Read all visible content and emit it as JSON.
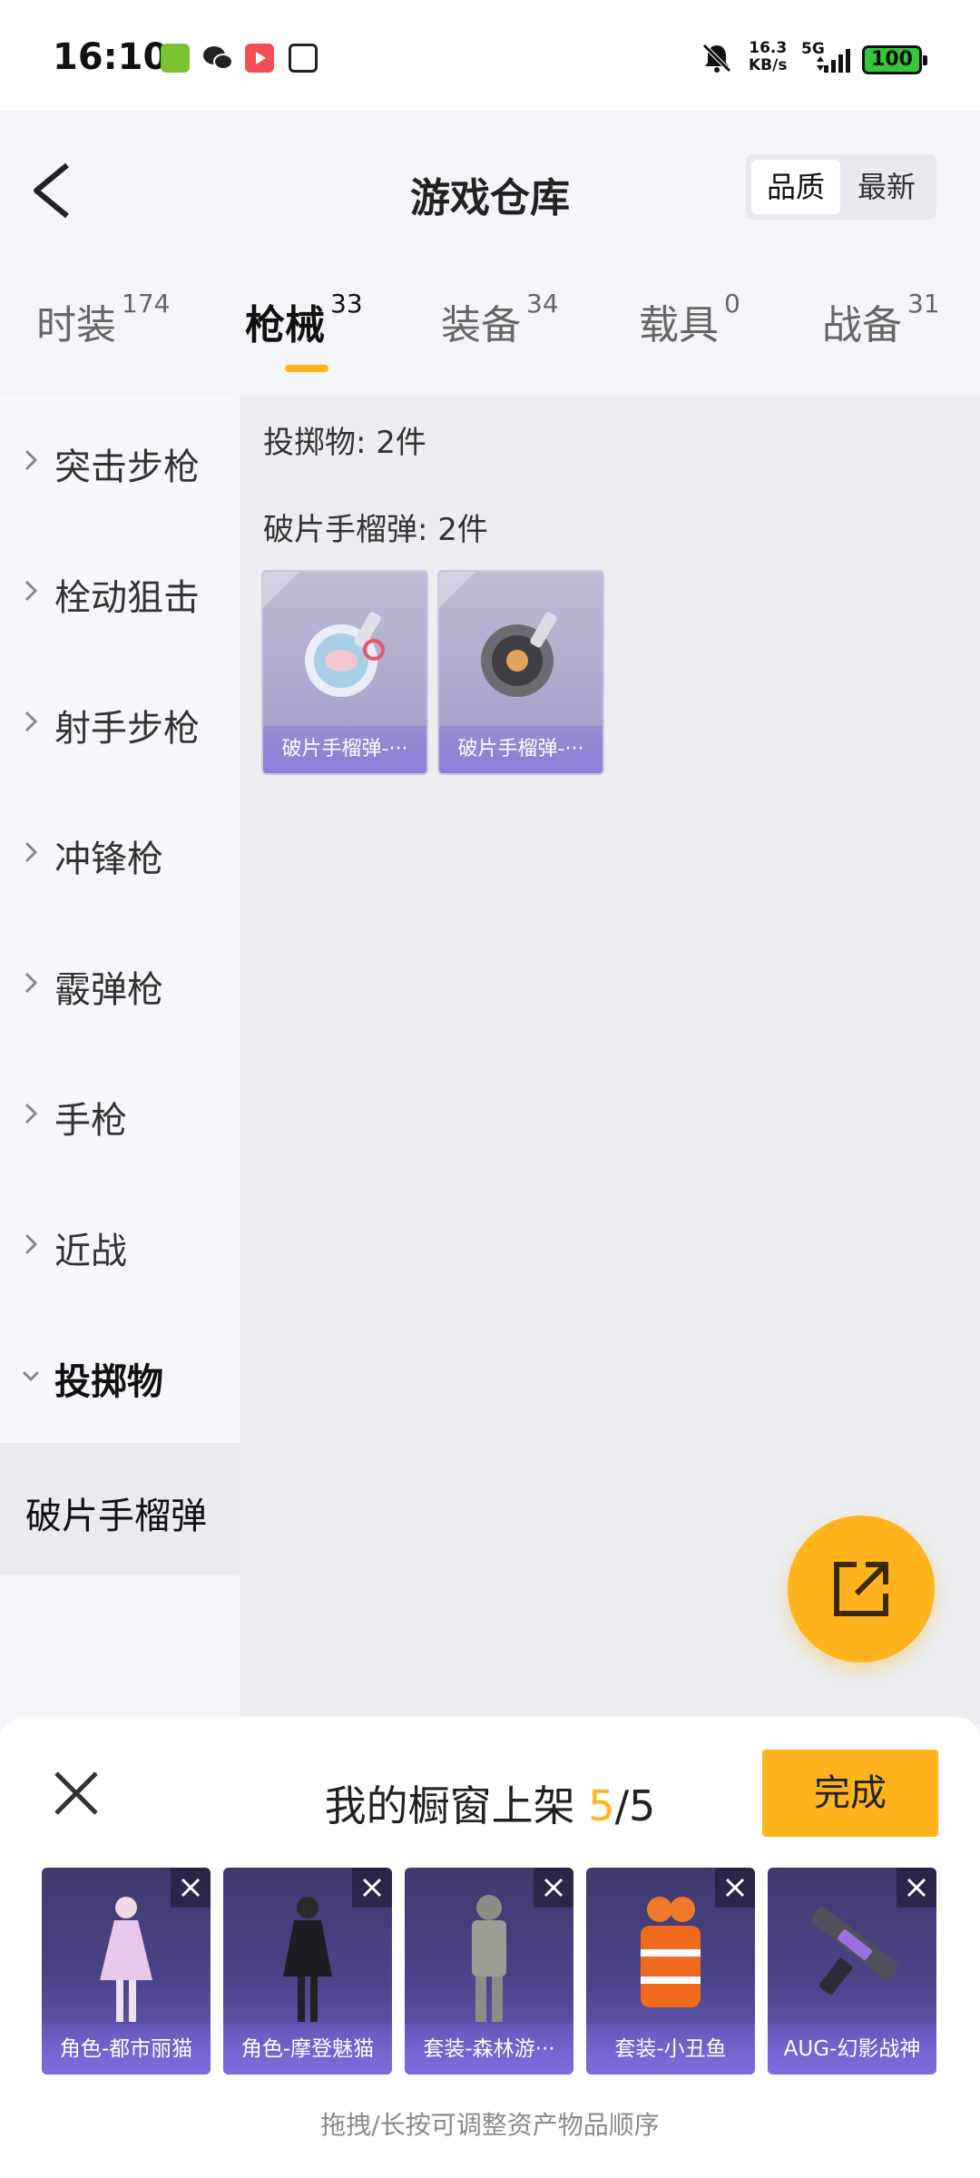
{
  "status_bar": {
    "time": "16:10",
    "speed_value": "16.3",
    "speed_unit": "KB/s",
    "network": "5G",
    "battery": "100"
  },
  "header": {
    "title": "游戏仓库",
    "sort_options": [
      "品质",
      "最新"
    ]
  },
  "tabs": [
    {
      "label": "时装",
      "count": "174"
    },
    {
      "label": "枪械",
      "count": "33"
    },
    {
      "label": "装备",
      "count": "34"
    },
    {
      "label": "载具",
      "count": "0"
    },
    {
      "label": "战备",
      "count": "31"
    }
  ],
  "sidebar": {
    "items": [
      "突击步枪",
      "栓动狙击",
      "射手步枪",
      "冲锋枪",
      "霰弹枪",
      "手枪",
      "近战",
      "投掷物"
    ],
    "selected_sub": "破片手榴弹"
  },
  "content": {
    "category_label": "投掷物: 2件",
    "group_label": "破片手榴弹: 2件",
    "items": [
      {
        "name": "破片手榴弹-···"
      },
      {
        "name": "破片手榴弹-···"
      }
    ]
  },
  "panel": {
    "title_prefix": "我的橱窗上架",
    "count_current": "5",
    "count_total": "/5",
    "done_label": "完成",
    "showcase": [
      {
        "name": "角色-都市丽猫"
      },
      {
        "name": "角色-摩登魅猫"
      },
      {
        "name": "套装-森林游···"
      },
      {
        "name": "套装-小丑鱼"
      },
      {
        "name": "AUG-幻影战神"
      }
    ],
    "hint": "拖拽/长按可调整资产物品顺序"
  },
  "colors": {
    "accent": "#ffb41e",
    "card_purple": "#8c7fdc"
  }
}
